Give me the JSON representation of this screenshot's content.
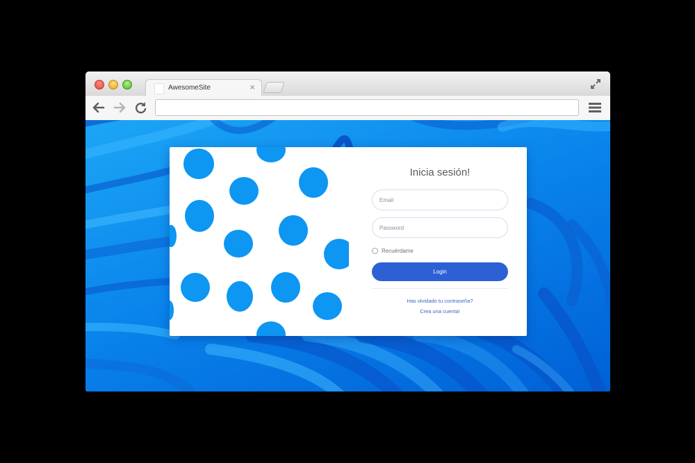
{
  "browser": {
    "tab_title": "AwesomeSite",
    "tab_close": "×",
    "url": "",
    "icons": [
      "close-dot",
      "minimize-dot",
      "zoom-dot",
      "back-arrow-icon",
      "forward-arrow-icon",
      "reload-icon",
      "hamburger-menu-icon",
      "fullscreen-icon"
    ]
  },
  "login": {
    "title": "Inicia sesión!",
    "email_placeholder": "Email",
    "password_placeholder": "Password",
    "remember_label": "Recuérdame",
    "button_label": "Login",
    "forgot_link": "Has olvidado tu contraseña?",
    "create_link": "Crea una cuenta!"
  },
  "colors": {
    "background_blue": "#0a85ec",
    "dot_blue": "#0d96f2",
    "button_blue": "#2d5fd5",
    "link_blue": "#3a63c9"
  }
}
